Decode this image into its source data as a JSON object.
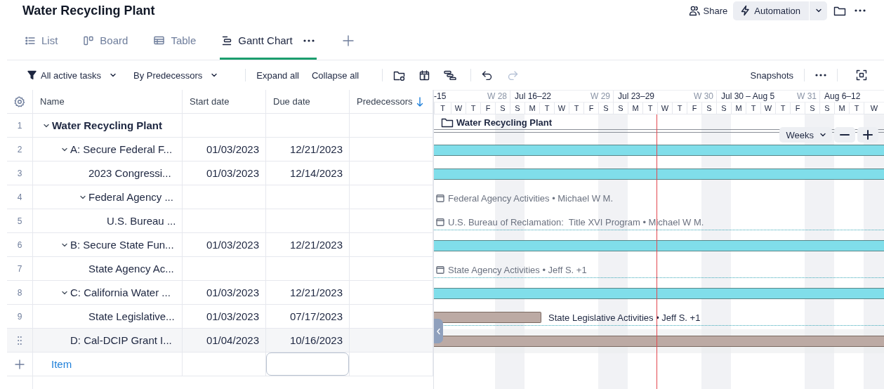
{
  "header": {
    "title": "Water Recycling Plant",
    "share": "Share",
    "automation": "Automation"
  },
  "tabs": [
    {
      "kind": "list",
      "label": "List",
      "selected": false
    },
    {
      "kind": "board",
      "label": "Board",
      "selected": false
    },
    {
      "kind": "table",
      "label": "Table",
      "selected": false
    },
    {
      "kind": "gantt",
      "label": "Gantt Chart",
      "selected": true
    }
  ],
  "toolbar": {
    "filter": "All active tasks",
    "group": "By Predecessors",
    "actions": [
      "Expand all",
      "Collapse all"
    ],
    "undo": {
      "disabled": false
    },
    "redo": {
      "disabled": true
    },
    "snapshots": "Snapshots"
  },
  "table": {
    "columns": [
      {
        "label": "Name",
        "sorted": false
      },
      {
        "label": "Start date",
        "sorted": false
      },
      {
        "label": "Due date",
        "sorted": false
      },
      {
        "label": "Predecessors",
        "sorted": true
      }
    ],
    "rows": [
      {
        "number": "1",
        "name": "Water Recycling Plant",
        "hovered": false,
        "expanded": true,
        "children": [
          {
            "number": "2",
            "name": "A: Secure Federal F...",
            "start": "01/03/2023",
            "due": "12/21/2023",
            "hovered": false,
            "expanded": true,
            "children": [
              {
                "number": "3",
                "name": "2023 Congressi...",
                "start": "01/03/2023",
                "due": "12/14/2023",
                "hovered": false
              },
              {
                "number": "4",
                "name": "Federal Agency ...",
                "hovered": false,
                "expanded": true,
                "children": [
                  {
                    "number": "5",
                    "name": "U.S. Bureau ...",
                    "hovered": false
                  }
                ]
              }
            ]
          },
          {
            "number": "6",
            "name": "B: Secure State Fun...",
            "start": "01/03/2023",
            "due": "12/21/2023",
            "hovered": false,
            "expanded": true,
            "children": [
              {
                "number": "7",
                "name": "State Agency Ac...",
                "hovered": false
              }
            ]
          },
          {
            "number": "8",
            "name": "C: California Water ...",
            "start": "01/03/2023",
            "due": "12/21/2023",
            "hovered": false,
            "expanded": true,
            "children": [
              {
                "number": "9",
                "name": "State Legislative...",
                "start": "01/03/2023",
                "due": "07/17/2023",
                "hovered": false
              }
            ]
          },
          {
            "name": "D: Cal-DCIP Grant I...",
            "start": "01/04/2023",
            "due": "10/16/2023",
            "hovered": true
          }
        ]
      }
    ],
    "add_row": {
      "label": "Item"
    }
  },
  "gantt": {
    "timeline": {
      "weeks": [
        {
          "label": "-15",
          "week": "W 28",
          "days": [
            {
              "label": "T",
              "today": false
            },
            {
              "label": "W",
              "today": false
            },
            {
              "label": "T",
              "today": false
            },
            {
              "label": "F",
              "today": false
            },
            {
              "label": "S",
              "today": false
            }
          ]
        },
        {
          "label": "Jul 16–22",
          "week": "W 29",
          "days": [
            {
              "label": "S",
              "today": false
            },
            {
              "label": "M",
              "today": false
            },
            {
              "label": "T",
              "today": false
            },
            {
              "label": "W",
              "today": false
            },
            {
              "label": "T",
              "today": false
            },
            {
              "label": "F",
              "today": false
            },
            {
              "label": "S",
              "today": false
            }
          ]
        },
        {
          "label": "Jul 23–29",
          "week": "W 30",
          "days": [
            {
              "label": "S",
              "today": false
            },
            {
              "label": "M",
              "today": false
            },
            {
              "label": "T",
              "today": true
            },
            {
              "label": "W",
              "today": false
            },
            {
              "label": "T",
              "today": false
            },
            {
              "label": "F",
              "today": false
            },
            {
              "label": "S",
              "today": false
            }
          ]
        },
        {
          "label": "Jul 30 – Aug 5",
          "week": "W 31",
          "days": [
            {
              "label": "S",
              "today": false
            },
            {
              "label": "M",
              "today": false
            },
            {
              "label": "T",
              "today": false
            },
            {
              "label": "W",
              "today": false
            },
            {
              "label": "T",
              "today": false
            },
            {
              "label": "F",
              "today": false
            },
            {
              "label": "S",
              "today": false
            }
          ]
        },
        {
          "label": "Aug 6–12",
          "days": [
            {
              "label": "S",
              "today": false
            },
            {
              "label": "M",
              "today": false
            },
            {
              "label": "T",
              "today": false
            },
            {
              "label": "W",
              "today": false
            }
          ]
        }
      ]
    },
    "rows": [
      {
        "kind": "summary",
        "label": "Water Recycling Plant",
        "dotted": false
      },
      {
        "kind": "bar",
        "color": "#80deea",
        "dotted": false
      },
      {
        "kind": "bar",
        "color": "#80deea",
        "dotted": false
      },
      {
        "kind": "label",
        "label": "Federal Agency Activities • Michael W M.",
        "dotted": false
      },
      {
        "kind": "label",
        "label": "U.S. Bureau of Reclamation:  Title XVI Program • Michael W M.",
        "dotted": true
      },
      {
        "kind": "bar",
        "color": "#80deea",
        "dotted": false
      },
      {
        "kind": "label",
        "label": "State Agency Activities • Jeff S. +1",
        "dotted": true
      },
      {
        "kind": "bar",
        "color": "#80deea",
        "dotted": false
      },
      {
        "kind": "short-bar",
        "color": "#bcaaa4",
        "label": "State Legislative Activities • Jeff S. +1",
        "dotted": true
      },
      {
        "kind": "bar",
        "color": "#bcaaa4",
        "dotted": false
      }
    ],
    "scale": "Weeks"
  }
}
